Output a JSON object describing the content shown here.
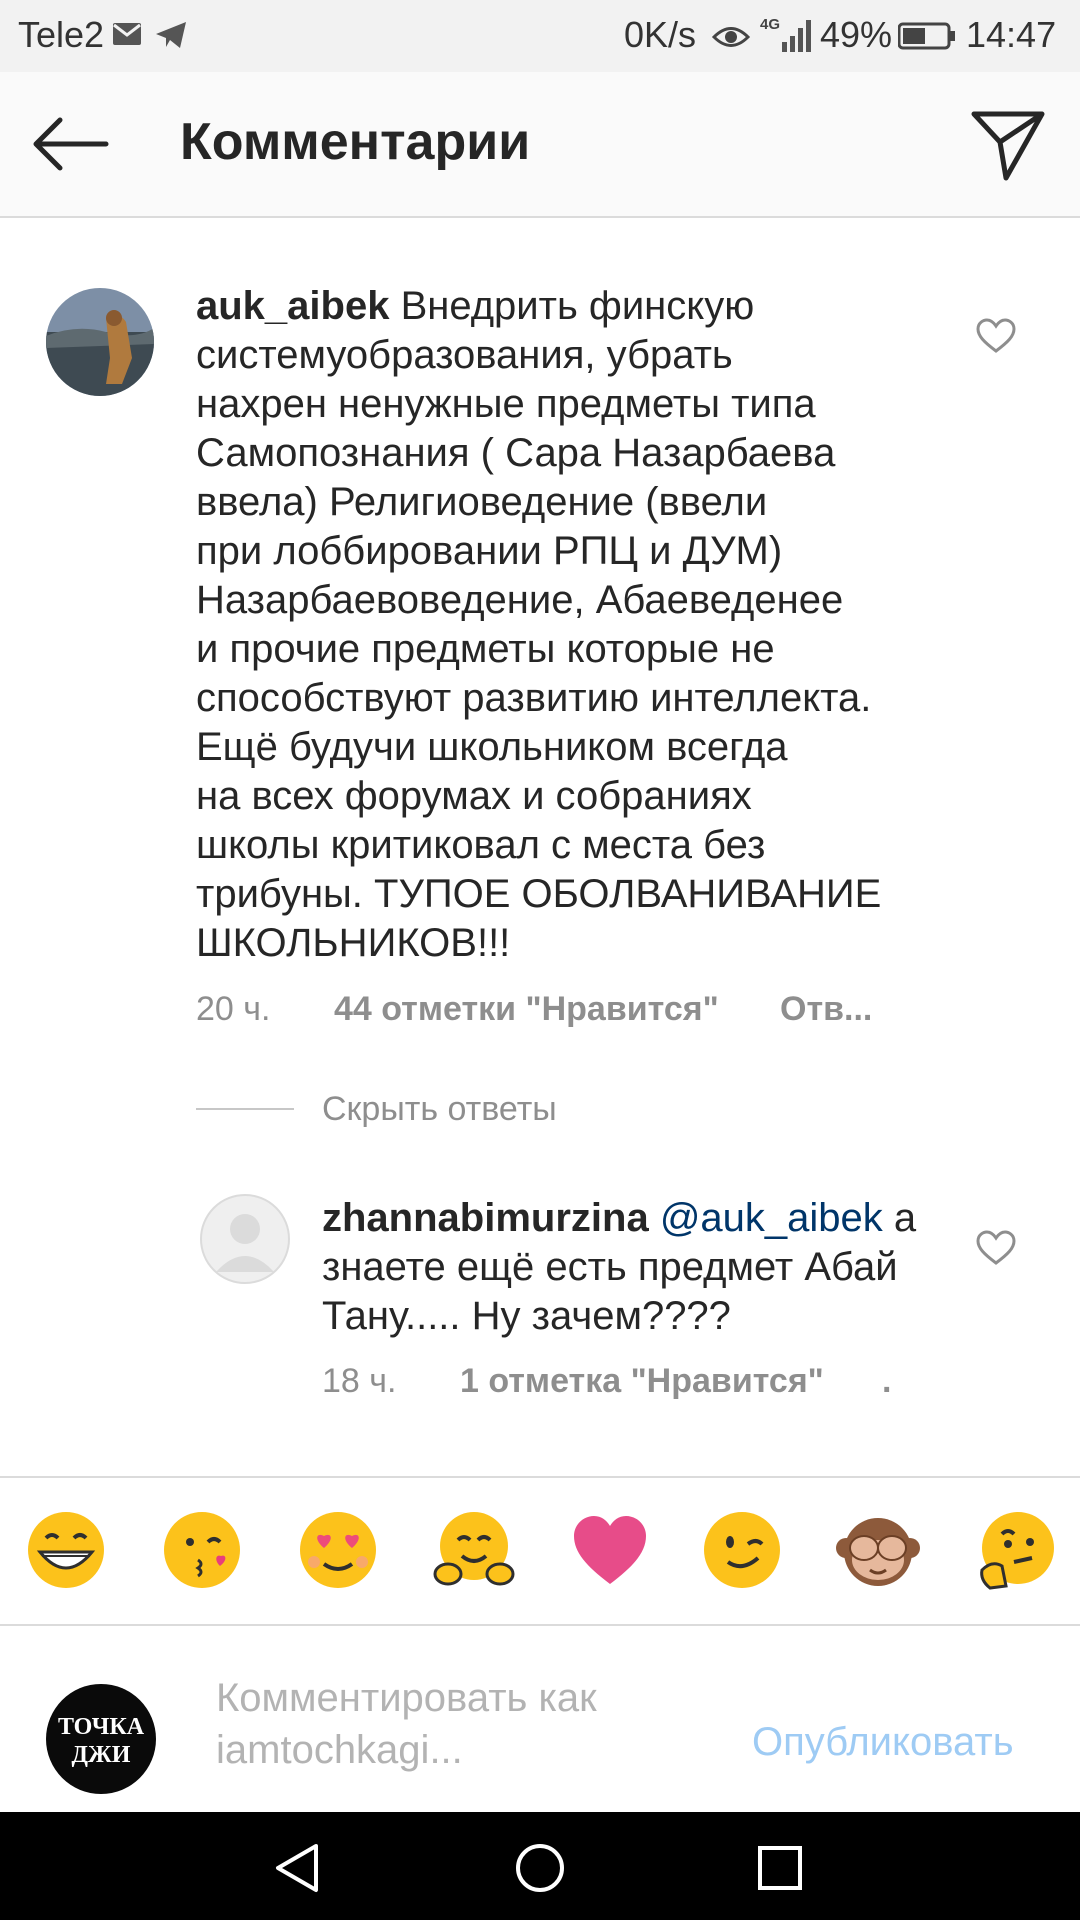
{
  "status_bar": {
    "carrier": "Tele2",
    "speed": "0K/s",
    "network": "4G",
    "battery": "49%",
    "time": "14:47",
    "icons": [
      "mail-icon",
      "telegram-icon",
      "eye-icon",
      "signal-icon",
      "battery-icon"
    ]
  },
  "header": {
    "title": "Комментарии",
    "back_icon": "arrow-left-icon",
    "share_icon": "paper-plane-icon"
  },
  "comments": [
    {
      "username": "auk_aibek",
      "lines": [
        " Внедрить финскую",
        "системуобразования, убрать",
        "нахрен ненужные предметы типа",
        "Самопознания ( Сара Назарбаева",
        "ввела) Религиоведение (ввели",
        "при лоббировании РПЦ и ДУМ)",
        "Назарбаевоведение, Абаеведенее",
        "и прочие предметы которые не",
        "способствуют развитию интеллекта.",
        "Ещё будучи школьником всегда",
        "на всех форумах и собраниях",
        "школы критиковал с места без",
        "трибуны. ТУПОЕ ОБОЛВАНИВАНИЕ",
        "ШКОЛЬНИКОВ!!!"
      ],
      "time": "20 ч.",
      "likes": "44 отметки \"Нравится\"",
      "reply": "Отв..."
    }
  ],
  "hide_replies": "Скрыть ответы",
  "replies": [
    {
      "username": "zhannabimurzina",
      "mention": "@auk_aibek",
      "first_line_rest": " а",
      "lines": [
        "знаете ещё есть предмет Абай",
        "Тану..... Ну зачем????"
      ],
      "time": "18 ч.",
      "likes": "1 отметка \"Нравится\"",
      "reply": "."
    }
  ],
  "emojis": [
    "grinning-face",
    "face-blowing-kiss",
    "heart-eyes-face",
    "hugging-face",
    "pink-heart",
    "winking-face",
    "see-no-evil-monkey",
    "thinking-face"
  ],
  "comment_input": {
    "avatar_text_line1": "ТОЧКА",
    "avatar_text_line2": "ДЖИ",
    "placeholder_line1": "Комментировать как",
    "placeholder_line2": "iamtochkagi...",
    "publish": "Опубликовать"
  },
  "nav_bar": [
    "back-triangle-icon",
    "home-circle-icon",
    "recents-square-icon"
  ]
}
